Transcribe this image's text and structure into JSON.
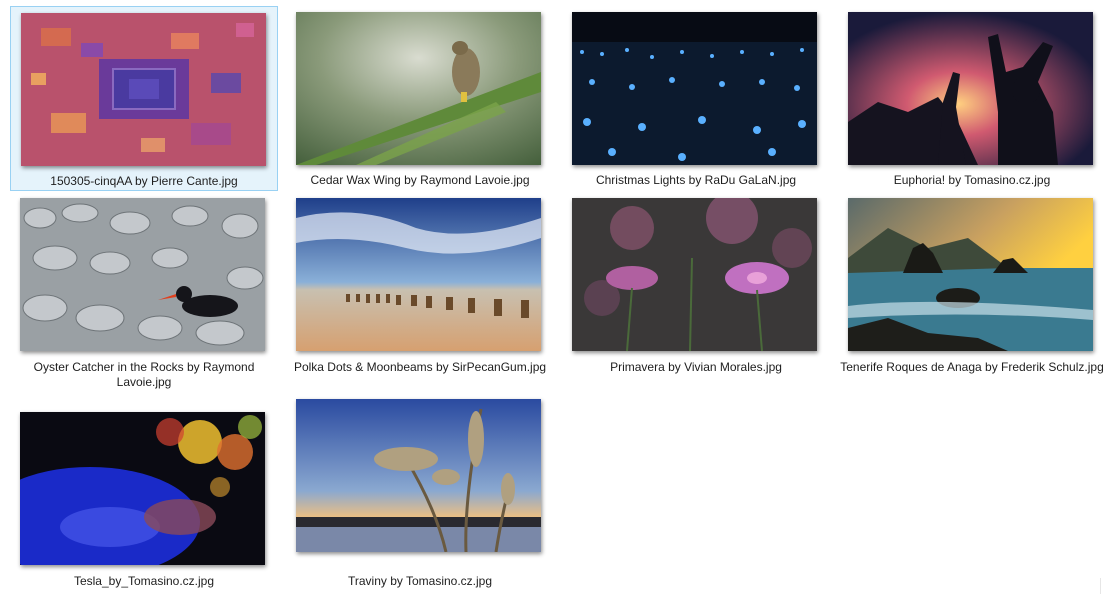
{
  "files": [
    {
      "name": "150305-cinqAA by Pierre Cante.jpg",
      "selected": true
    },
    {
      "name": "Cedar Wax Wing by Raymond Lavoie.jpg"
    },
    {
      "name": "Christmas Lights by RaDu GaLaN.jpg"
    },
    {
      "name": "Euphoria! by Tomasino.cz.jpg"
    },
    {
      "name": "Oyster Catcher in the Rocks by Raymond Lavoie.jpg"
    },
    {
      "name": "Polka Dots & Moonbeams by SirPecanGum.jpg"
    },
    {
      "name": "Primavera by Vivian Morales.jpg"
    },
    {
      "name": "Tenerife Roques de Anaga by Frederik Schulz.jpg"
    },
    {
      "name": "Tesla_by_Tomasino.cz.jpg"
    },
    {
      "name": "Traviny by Tomasino.cz.jpg"
    }
  ]
}
